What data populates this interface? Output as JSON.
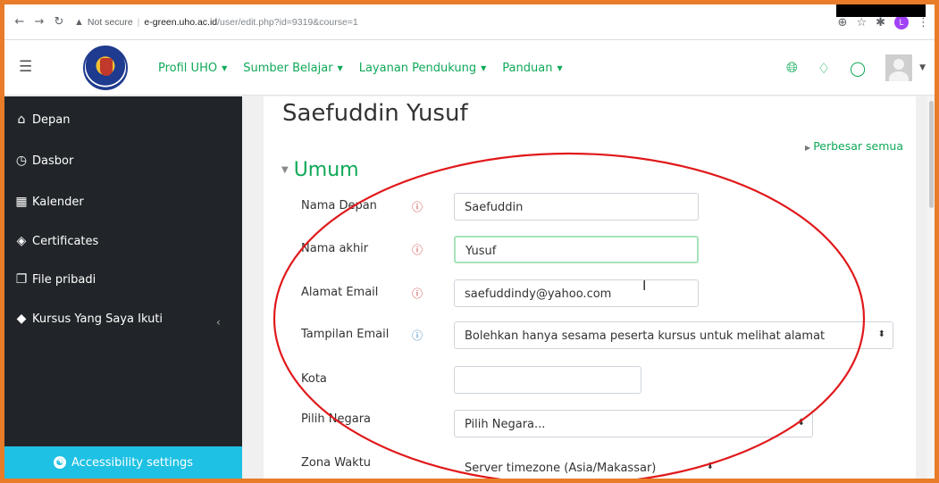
{
  "browser": {
    "not_secure": "Not secure",
    "url_host": "e-green.uho.ac.id",
    "url_path": "/user/edit.php?id=9319&course=1",
    "profile_letter": "L"
  },
  "navbar": {
    "links": [
      {
        "label": "Profil UHO"
      },
      {
        "label": "Sumber Belajar"
      },
      {
        "label": "Layanan Pendukung"
      },
      {
        "label": "Panduan"
      }
    ]
  },
  "sidebar": {
    "items": [
      {
        "label": "Depan",
        "icon": "home-icon"
      },
      {
        "label": "Dasbor",
        "icon": "dashboard-icon"
      },
      {
        "label": "Kalender",
        "icon": "calendar-icon"
      },
      {
        "label": "Certificates",
        "icon": "certificate-icon"
      },
      {
        "label": "File pribadi",
        "icon": "file-icon"
      },
      {
        "label": "Kursus Yang Saya Ikuti",
        "icon": "graduation-cap-icon"
      }
    ],
    "accessibility_label": "Accessibility settings"
  },
  "main": {
    "title": "Saefuddin Yusuf",
    "expand_all": "Perbesar semua",
    "section": "Umum",
    "fields": {
      "first_name": {
        "label": "Nama Depan",
        "value": "Saefuddin"
      },
      "last_name": {
        "label": "Nama akhir",
        "value": "Yusuf"
      },
      "email": {
        "label": "Alamat Email",
        "value": "saefuddindy@yahoo.com"
      },
      "email_display": {
        "label": "Tampilan Email",
        "value": "Bolehkan hanya sesama peserta kursus untuk melihat alamat"
      },
      "city": {
        "label": "Kota",
        "value": ""
      },
      "country": {
        "label": "Pilih Negara",
        "value": "Pilih Negara..."
      },
      "timezone": {
        "label": "Zona Waktu",
        "value": "Server timezone (Asia/Makassar)"
      }
    }
  },
  "colors": {
    "accent_green": "#0fa958",
    "sidebar_bg": "#212529",
    "a11y_bg": "#1ec1e4",
    "annotation_red": "#e0191b",
    "frame_orange": "#e87c28"
  }
}
